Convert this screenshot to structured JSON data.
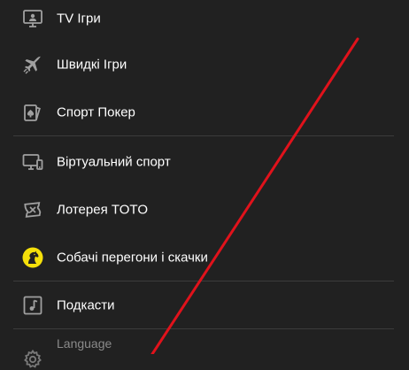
{
  "menu": {
    "items": [
      {
        "label": "TV Ігри",
        "icon": "tv-icon"
      },
      {
        "label": "Швидкі Ігри",
        "icon": "plane-icon"
      },
      {
        "label": "Спорт Покер",
        "icon": "cards-icon"
      },
      {
        "label": "Віртуальний спорт",
        "icon": "monitor-icon"
      },
      {
        "label": "Лотерея TOTO",
        "icon": "lottery-ticket-icon"
      },
      {
        "label": "Собачі перегони і скачки",
        "icon": "horse-head-icon"
      },
      {
        "label": "Подкасти",
        "icon": "music-note-icon"
      }
    ],
    "language": {
      "label": "Language",
      "icon": "gear-icon"
    }
  },
  "colors": {
    "background": "#212121",
    "icon": "#a0a0a0",
    "accent_yellow": "#f5e00a",
    "overlay_line": "#e0121b"
  }
}
